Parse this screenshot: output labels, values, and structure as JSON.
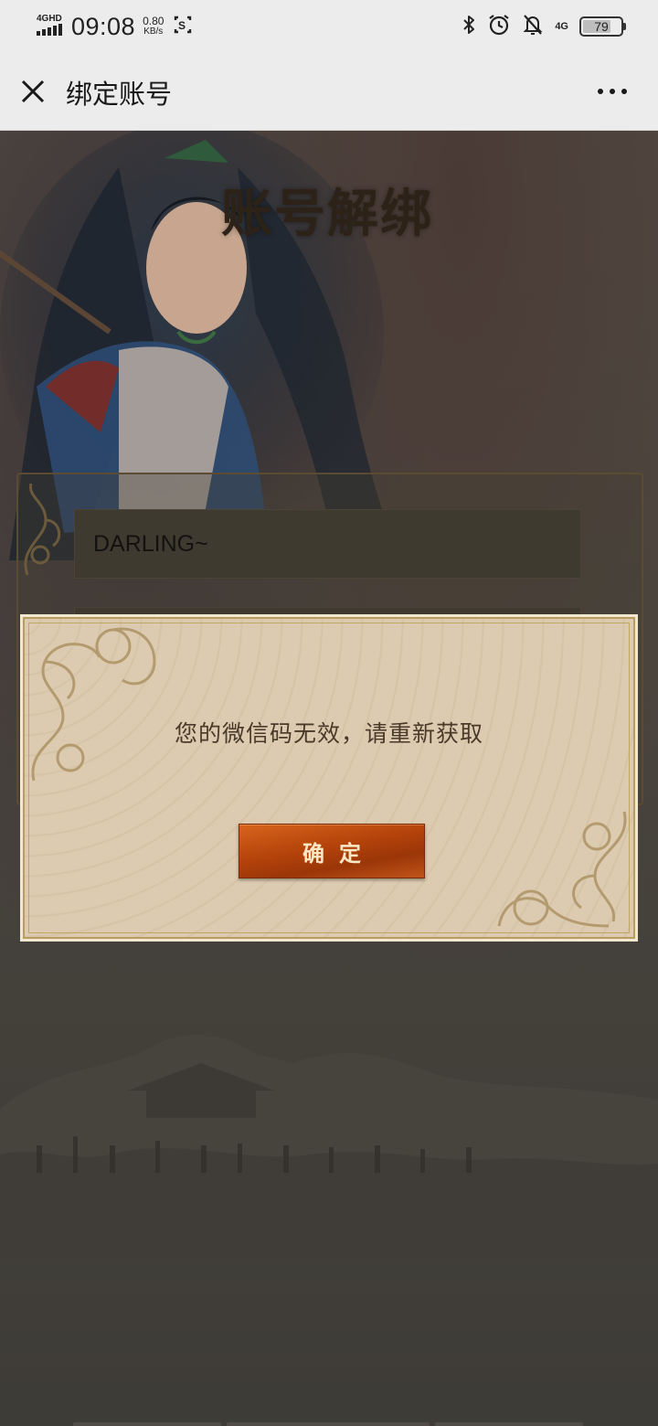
{
  "status_bar": {
    "network_tag": "4GHD",
    "time": "09:08",
    "speed_value": "0.80",
    "speed_unit": "KB/s",
    "net_type": "4G",
    "battery": "79",
    "icons": [
      "screenshot-icon",
      "bluetooth-icon",
      "alarm-icon",
      "mute-icon"
    ]
  },
  "nav": {
    "title": "绑定账号"
  },
  "page": {
    "hero_title": "账号解绑",
    "account_input_value": "DARLING~"
  },
  "modal": {
    "message": "您的微信码无效，请重新获取",
    "confirm_label": "确定"
  },
  "colors": {
    "nav_bg": "#ececec",
    "modal_bg": "#dccbb0",
    "confirm_btn": "#b3420b",
    "page_bg": "#4d473f"
  }
}
